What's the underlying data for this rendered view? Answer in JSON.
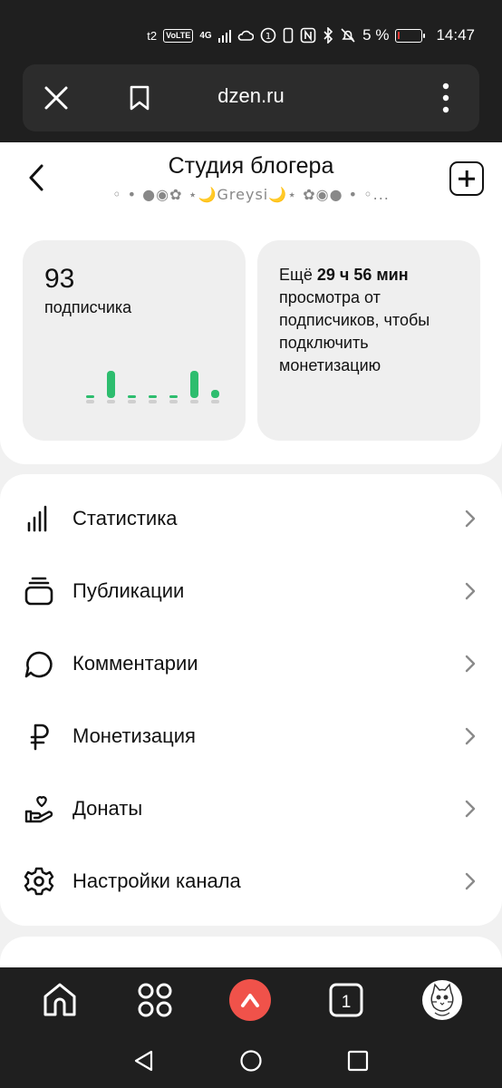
{
  "status_bar": {
    "operator": "t2",
    "volte": "VoLTE",
    "network": "4G",
    "sim_badge": "1",
    "battery_percent": "5 %",
    "battery_level": 0.05,
    "time": "14:47"
  },
  "browser": {
    "url": "dzen.ru"
  },
  "header": {
    "title": "Студия блогера",
    "channel_name": "◦ • ●◉✿ ⋆🌙Greysi🌙⋆ ✿◉● • ◦..."
  },
  "subscribers": {
    "count": "93",
    "label": "подписчика",
    "chart_values": [
      0,
      1,
      0,
      0,
      0,
      1,
      0.3
    ]
  },
  "monetization": {
    "prefix": "Ещё ",
    "hours": "29",
    "hours_unit": " ч ",
    "minutes": "56",
    "minutes_unit": " мин",
    "rest": "просмотра от подписчиков, чтобы подключить монетизацию"
  },
  "menu": {
    "items": [
      {
        "label": "Статистика",
        "icon": "bar-chart-icon"
      },
      {
        "label": "Публикации",
        "icon": "publications-icon"
      },
      {
        "label": "Комментарии",
        "icon": "comment-icon"
      },
      {
        "label": "Монетизация",
        "icon": "ruble-icon"
      },
      {
        "label": "Донаты",
        "icon": "donate-icon"
      },
      {
        "label": "Настройки канала",
        "icon": "gear-icon"
      }
    ]
  },
  "bottom_nav": {
    "tabs_count": "1"
  }
}
